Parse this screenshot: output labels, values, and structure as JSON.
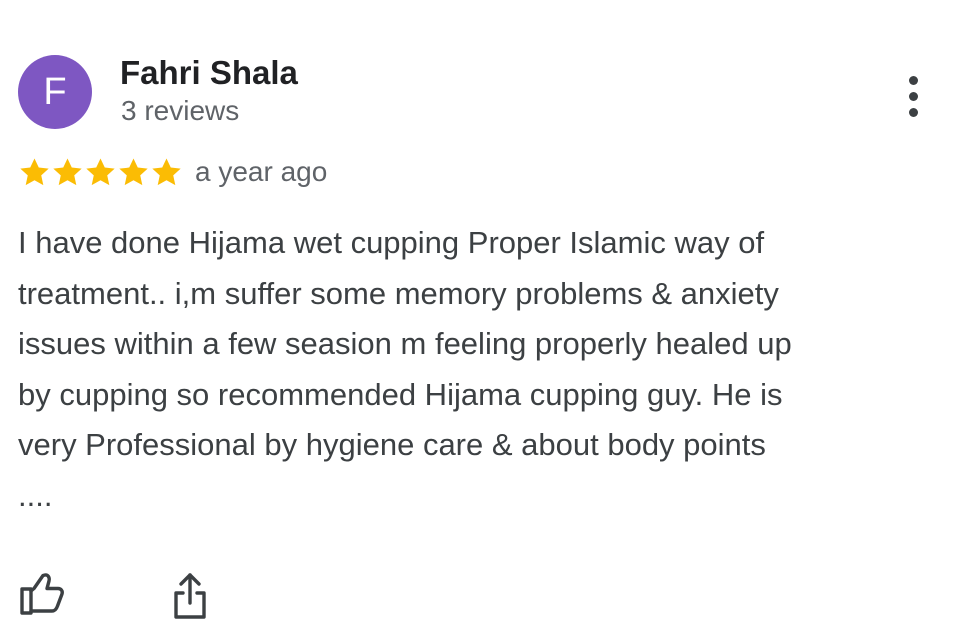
{
  "review": {
    "author": {
      "initial": "F",
      "name": "Fahri Shala",
      "review_count": "3 reviews",
      "avatar_color": "#7e57c2"
    },
    "rating": {
      "stars": 5,
      "max_stars": 5,
      "star_color": "#fbbc04"
    },
    "time_ago": "a year ago",
    "text_lines": [
      "I have done Hijama wet cupping Proper Islamic way of",
      "treatment.. i,m suffer some memory problems & anxiety",
      "issues within a few seasion m feeling properly healed up",
      "by cupping so recommended Hijama cupping guy. He is",
      "very Professional by hygiene care & about body points",
      "...."
    ],
    "icons": {
      "more": "more-vert-icon",
      "like": "thumb-up-icon",
      "share": "share-icon"
    }
  }
}
